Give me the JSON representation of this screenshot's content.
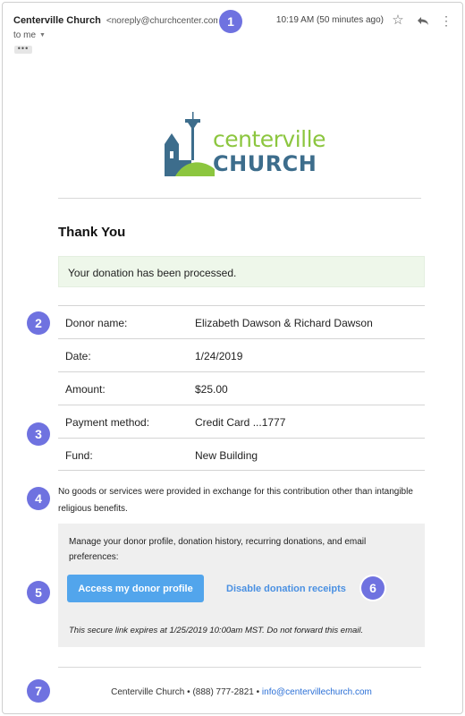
{
  "header": {
    "sender_name": "Centerville Church",
    "sender_email": "<noreply@churchcenter.com>",
    "to": "to me",
    "ellipsis": "•••",
    "time": "10:19 AM (50 minutes ago)"
  },
  "logo": {
    "line1": "centerville",
    "line2": "CHURCH",
    "colors": {
      "green": "#8cc63f",
      "blue": "#3d6d8c"
    }
  },
  "body": {
    "title": "Thank You",
    "processed_message": "Your donation has been processed.",
    "details": [
      {
        "label": "Donor name:",
        "value": "Elizabeth Dawson & Richard Dawson"
      },
      {
        "label": "Date:",
        "value": "1/24/2019"
      },
      {
        "label": "Amount:",
        "value": "$25.00"
      },
      {
        "label": "Payment method:",
        "value": "Credit Card ...1777"
      },
      {
        "label": "Fund:",
        "value": "New Building"
      }
    ],
    "notice": "No goods or services were provided in exchange for this contribution other than intangible religious benefits.",
    "manage_text": "Manage your donor profile, donation history, recurring donations, and email preferences:",
    "primary_button": "Access my donor profile",
    "disable_link": "Disable donation receipts",
    "expire_note": "This secure link expires at 1/25/2019 10:00am MST. Do not forward this email."
  },
  "footer": {
    "org": "Centerville Church",
    "phone": "(888) 777-2821",
    "email": "info@centervillechurch.com",
    "separator": "•"
  },
  "badges": [
    "1",
    "2",
    "3",
    "4",
    "5",
    "6",
    "7"
  ],
  "colors": {
    "badge": "#6f72e0",
    "button": "#52a5ec",
    "link": "#4a90e2",
    "success_bg": "#eef7ea"
  }
}
